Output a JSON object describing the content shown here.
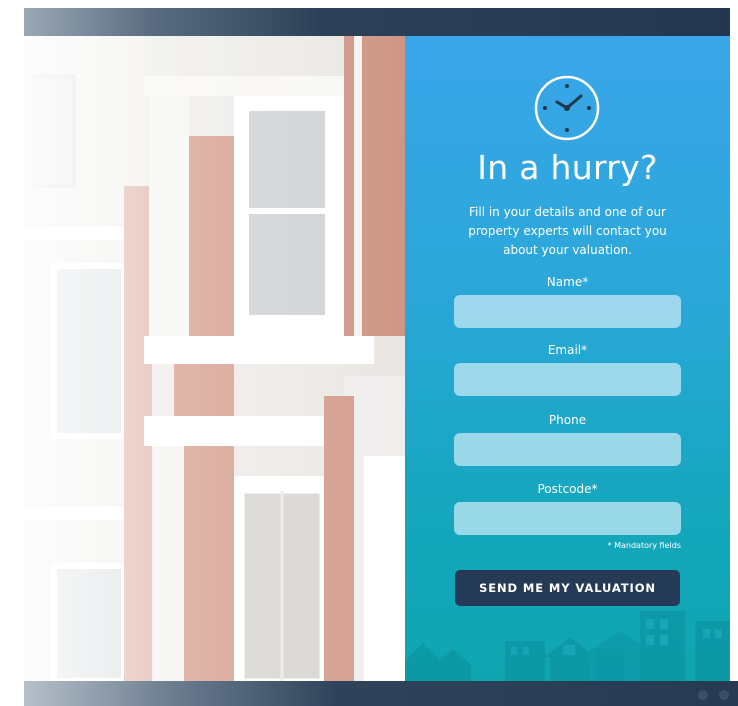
{
  "form": {
    "title": "In a hurry?",
    "description": "Fill in your details and one of our property experts will contact you about your valuation.",
    "fields": [
      {
        "label": "Name*",
        "value": "",
        "placeholder": ""
      },
      {
        "label": "Email*",
        "value": "",
        "placeholder": ""
      },
      {
        "label": "Phone",
        "value": "",
        "placeholder": ""
      },
      {
        "label": "Postcode*",
        "value": "",
        "placeholder": ""
      }
    ],
    "mandatory_note": "* Mandatory fields",
    "submit_label": "SEND ME MY VALUATION"
  },
  "icons": {
    "header_icon": "clock-icon"
  },
  "colors": {
    "panel_top": "#3aa6ea",
    "panel_bottom": "#0fa5b0",
    "button": "#243a55",
    "frame_bar": "#243750"
  }
}
